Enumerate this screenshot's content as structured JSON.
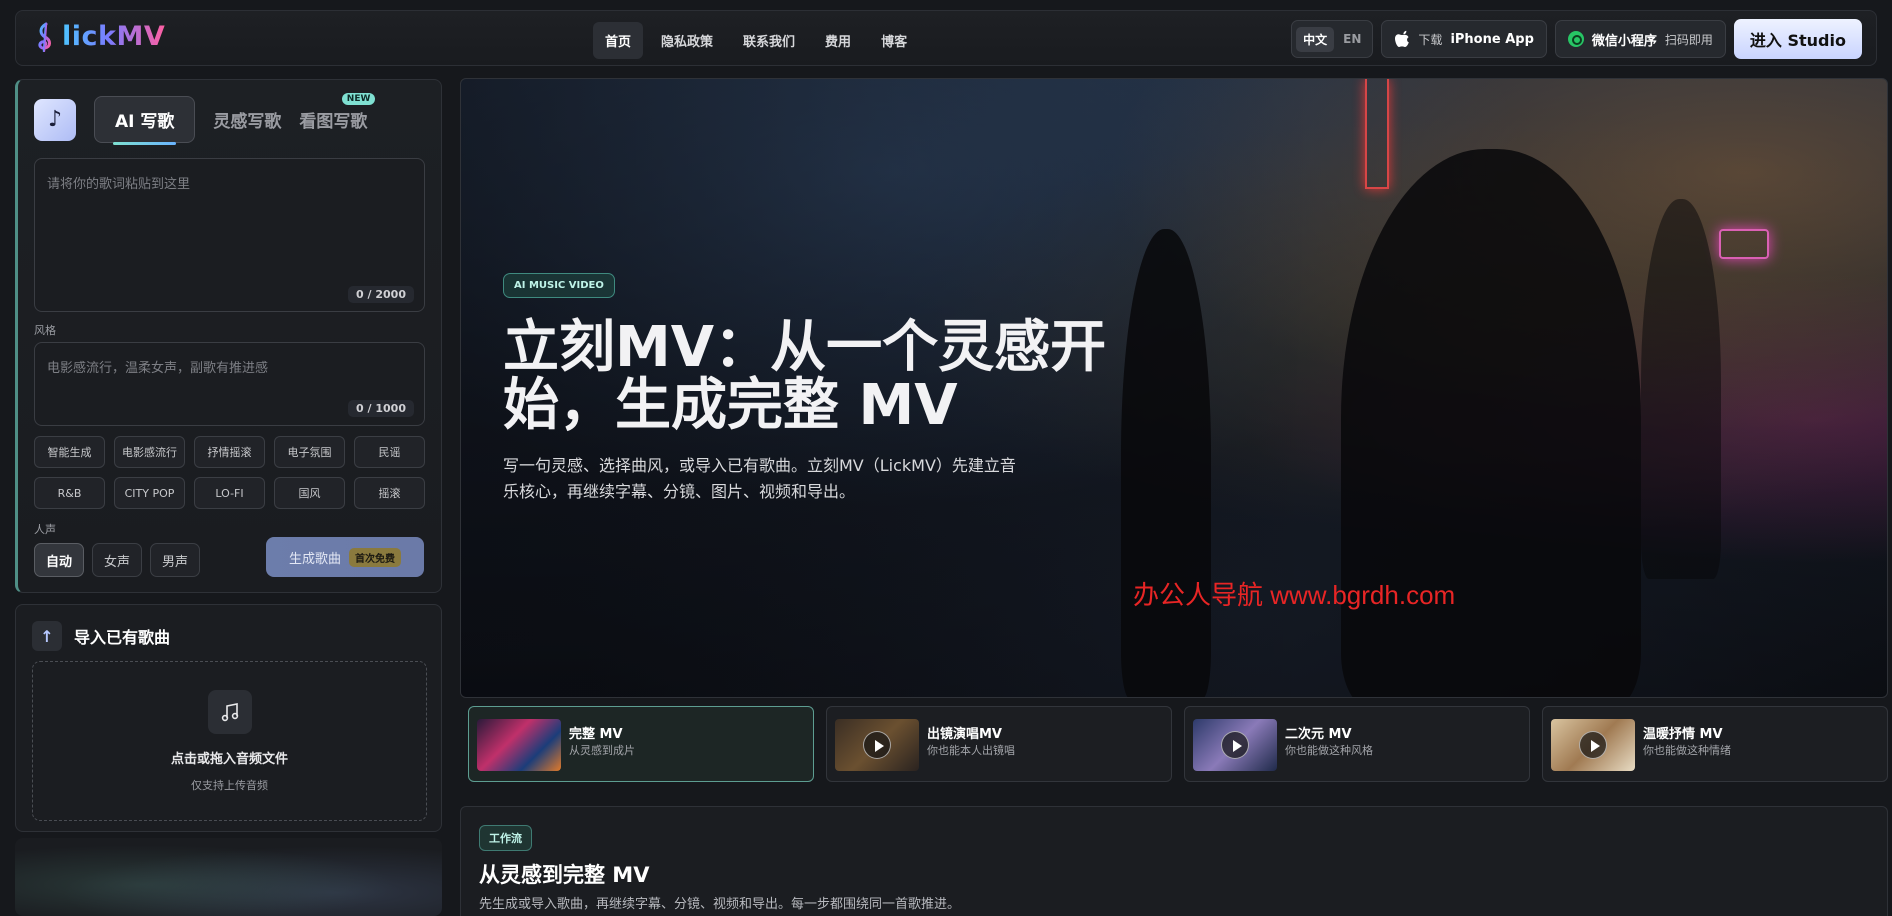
{
  "brand": {
    "name": "lickMV",
    "icon": "treble-clef-icon"
  },
  "nav": {
    "items": [
      "首页",
      "隐私政策",
      "联系我们",
      "费用",
      "博客"
    ],
    "active_index": 0
  },
  "toolbar": {
    "lang_zh": "中文",
    "lang_en": "EN",
    "download_prefix": "下载",
    "download_label": "iPhone App",
    "mini_program_label": "微信小程序",
    "mini_program_hint": "扫码即用",
    "studio_label": "进入 Studio"
  },
  "composer": {
    "tabs": [
      "AI 写歌",
      "灵感写歌",
      "看图写歌"
    ],
    "new_badge": "NEW",
    "lyrics_placeholder": "请将你的歌词粘贴到这里",
    "lyrics_counter": "0 / 2000",
    "style_label": "风格",
    "style_placeholder": "电影感流行，温柔女声，副歌有推进感",
    "style_counter": "0 / 1000",
    "style_chips": [
      "智能生成",
      "电影感流行",
      "抒情摇滚",
      "电子氛围",
      "民谣",
      "R&B",
      "CITY POP",
      "LO-FI",
      "国风",
      "摇滚"
    ],
    "voice_label": "人声",
    "voice_options": [
      "自动",
      "女声",
      "男声"
    ],
    "voice_selected": "自动",
    "generate_label": "生成歌曲",
    "generate_badge": "首次免费"
  },
  "import": {
    "title": "导入已有歌曲",
    "drop_main": "点击或拖入音频文件",
    "drop_sub": "仅支持上传音频"
  },
  "hero": {
    "tag": "AI MUSIC VIDEO",
    "title": "立刻MV：从一个灵感开始，生成完整 MV",
    "description": "写一句灵感、选择曲风，或导入已有歌曲。立刻MV（LickMV）先建立音乐核心，再继续字幕、分镜、图片、视频和导出。",
    "watermark": "办公人导航 www.bgrdh.com"
  },
  "video_tabs": [
    {
      "title": "完整 MV",
      "subtitle": "从灵感到成片",
      "active": true
    },
    {
      "title": "出镜演唱MV",
      "subtitle": "你也能本人出镜唱",
      "active": false
    },
    {
      "title": "二次元 MV",
      "subtitle": "你也能做这种风格",
      "active": false
    },
    {
      "title": "温暖抒情 MV",
      "subtitle": "你也能做这种情绪",
      "active": false
    }
  ],
  "workflow": {
    "tag": "工作流",
    "title": "从灵感到完整 MV",
    "description": "先生成或导入歌曲，再继续字幕、分镜、视频和导出。每一步都围绕同一首歌推进。"
  }
}
